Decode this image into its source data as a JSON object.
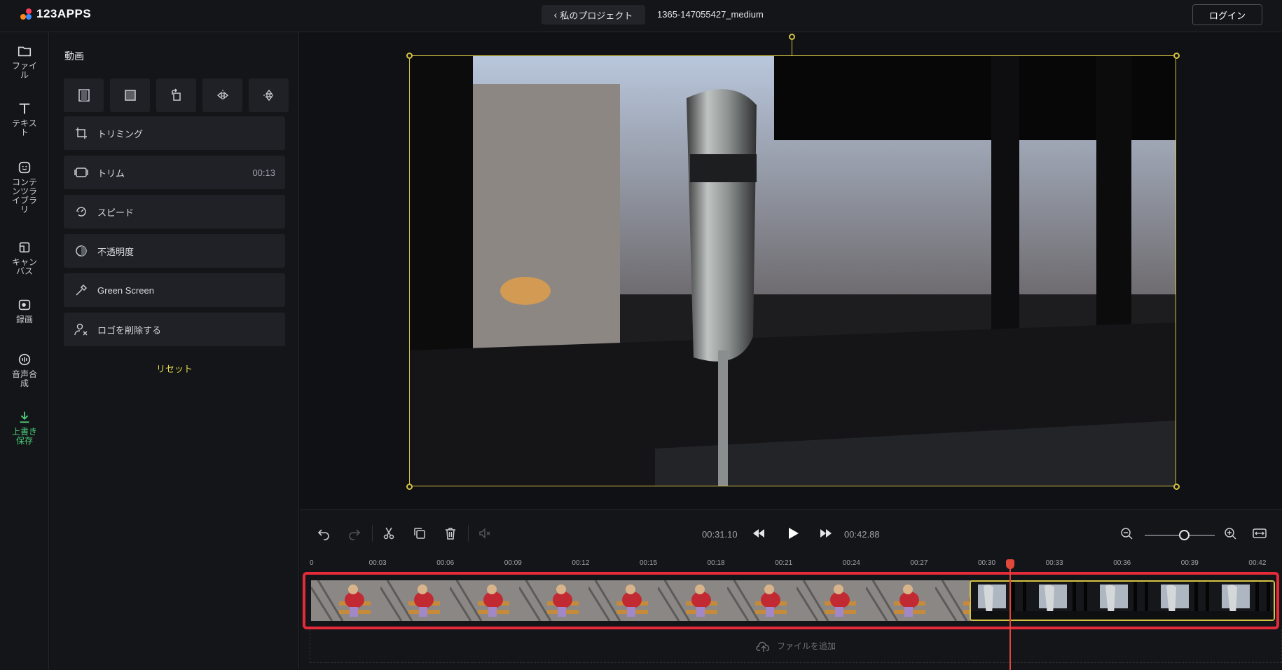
{
  "app": {
    "logo_text": "123APPS"
  },
  "header": {
    "back_label": "私のプロジェクト",
    "project_name": "1365-147055427_medium",
    "login_label": "ログイン"
  },
  "rail": {
    "items": [
      {
        "label": "ファイル",
        "icon": "folder-icon"
      },
      {
        "label": "テキスト",
        "icon": "text-icon"
      },
      {
        "label": "コンテンツライブラリ",
        "icon": "sticker-icon"
      },
      {
        "label": "キャンバス",
        "icon": "canvas-icon"
      },
      {
        "label": "録画",
        "icon": "record-icon"
      },
      {
        "label": "音声合成",
        "icon": "voice-icon"
      },
      {
        "label": "上書き保存",
        "icon": "download-icon"
      }
    ]
  },
  "panel": {
    "title": "動画",
    "options": [
      {
        "label": "トリミング",
        "value": ""
      },
      {
        "label": "トリム",
        "value": "00:13"
      },
      {
        "label": "スピード",
        "value": ""
      },
      {
        "label": "不透明度",
        "value": ""
      },
      {
        "label": "Green Screen",
        "value": ""
      },
      {
        "label": "ロゴを削除する",
        "value": ""
      }
    ],
    "reset_label": "リセット"
  },
  "controls": {
    "current_time": "00:31.10",
    "total_time": "00:42.88",
    "zoom_level": 0.56
  },
  "timeline": {
    "ticks": [
      "0",
      "00:03",
      "00:06",
      "00:09",
      "00:12",
      "00:15",
      "00:18",
      "00:21",
      "00:24",
      "00:27",
      "00:30",
      "00:33",
      "00:36",
      "00:39",
      "00:42"
    ],
    "add_file_label": "ファイルを追加"
  },
  "colors": {
    "accent": "#d6c243",
    "save": "#4bd07a",
    "highlight": "#e52b3a",
    "playhead": "#e2483a"
  }
}
